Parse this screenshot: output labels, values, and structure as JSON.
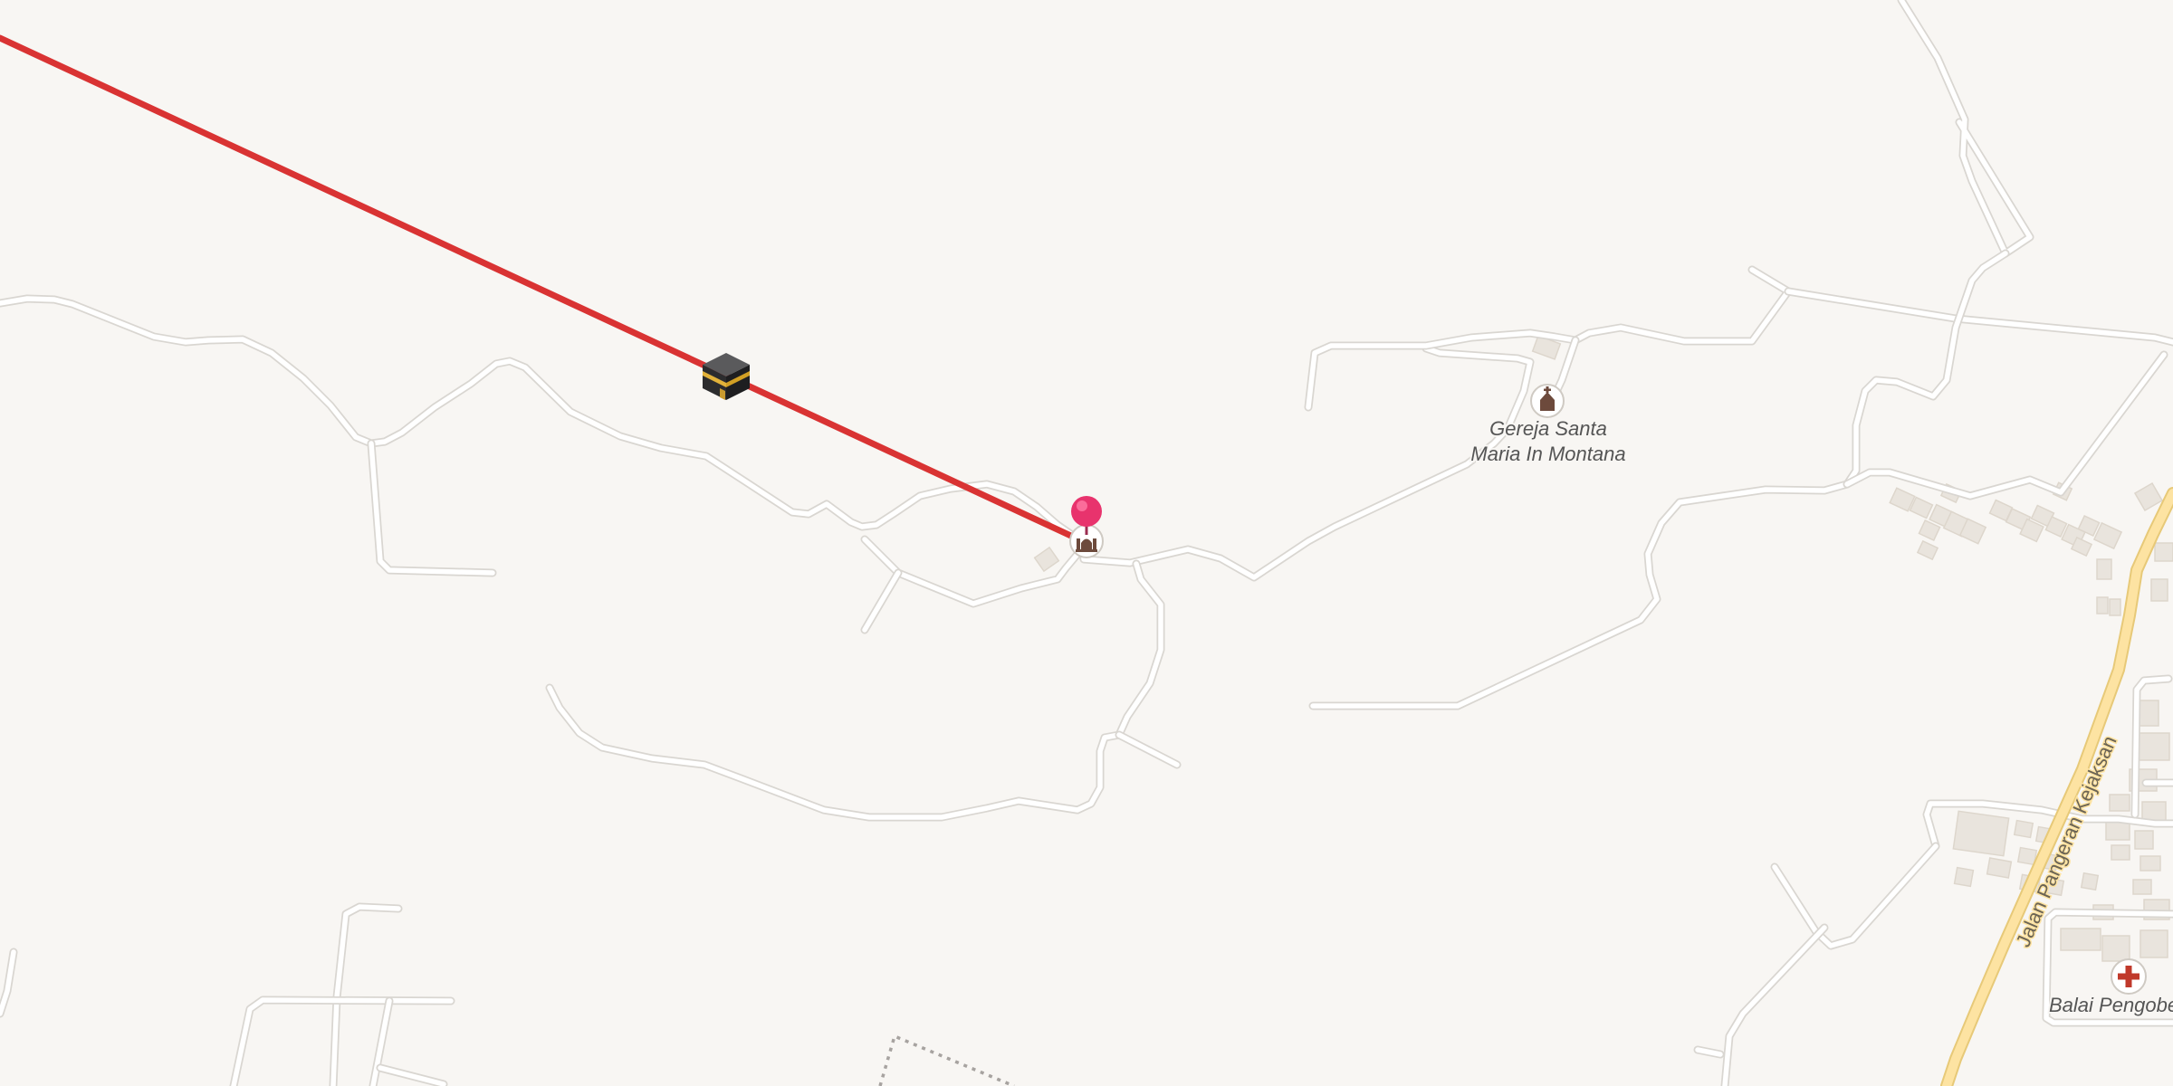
{
  "map": {
    "colors": {
      "background": "#f8f6f3",
      "qibla_line": "#d93333",
      "main_road": "#fde3a2",
      "minor_road": "#ffffff",
      "marker_pin": "#e8336d",
      "hospital_cross": "#c0392b"
    },
    "labels": {
      "church": "Gereja Santa Maria In Montana",
      "church_line1": "Gereja Santa",
      "church_line2": "Maria In Montana",
      "street": "Jalan Pangeran Kejaksan",
      "clinic": "Balai Pengobe"
    },
    "icons": {
      "kaaba": "kaaba-icon",
      "marker": "location-pin-icon",
      "mosque": "mosque-icon",
      "church": "church-icon",
      "clinic": "hospital-cross-icon"
    }
  }
}
